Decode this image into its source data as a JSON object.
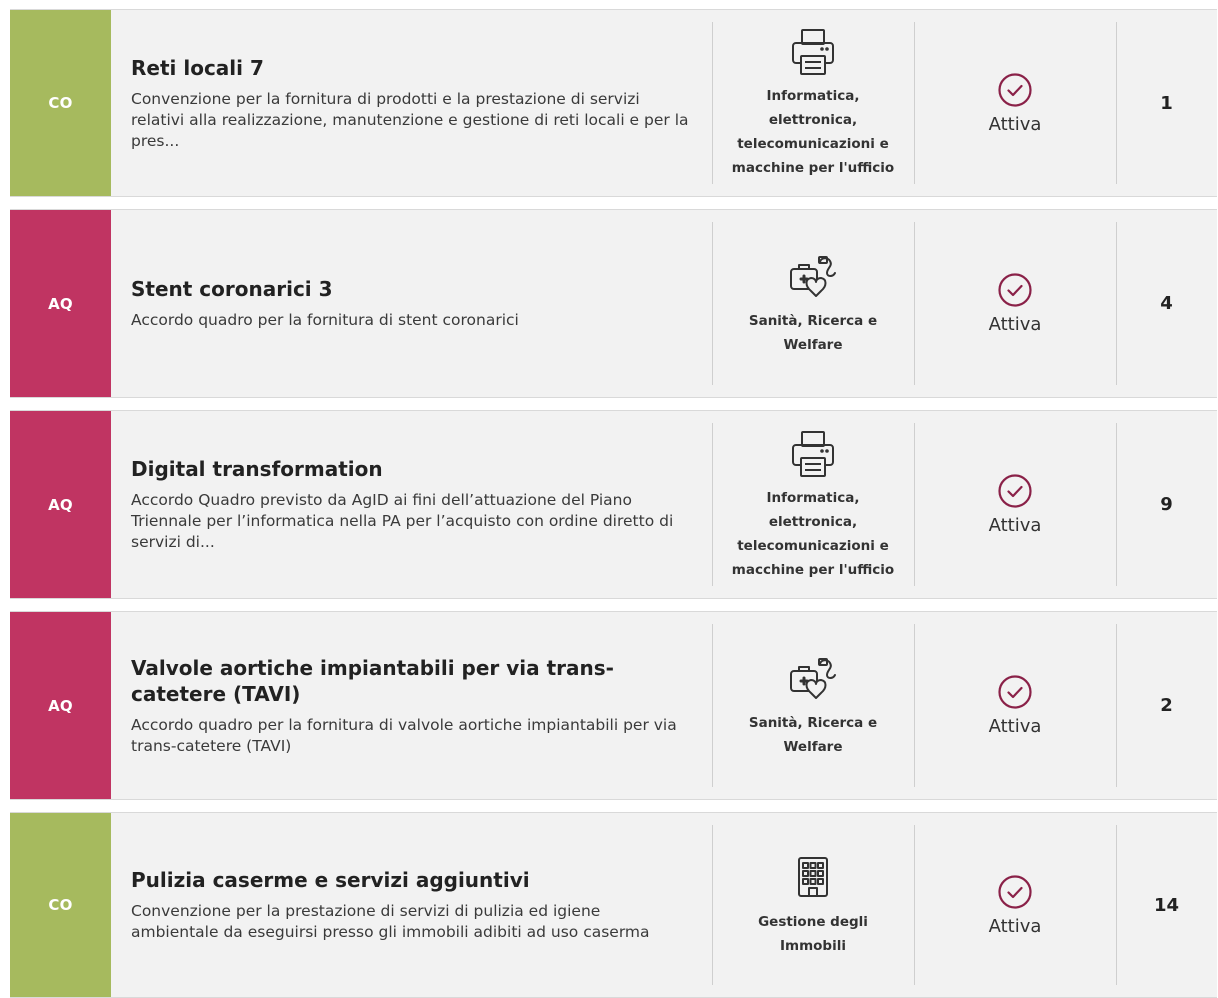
{
  "colors": {
    "co": "#a6ba5e",
    "aq": "#c03462",
    "status": "#8a2148"
  },
  "items": [
    {
      "type": "CO",
      "title": "Reti locali 7",
      "description": "Convenzione per la fornitura di prodotti e la prestazione di servizi relativi alla realizzazione, manutenzione e gestione di reti locali e per la pres...",
      "category_icon": "printer-icon",
      "category": "Informatica, elettronica, telecomunicazioni e macchine per l'ufficio",
      "status": "Attiva",
      "count": "1"
    },
    {
      "type": "AQ",
      "title": "Stent coronarici 3",
      "description": "Accordo quadro per la fornitura di stent coronarici",
      "category_icon": "health-icon",
      "category": "Sanità, Ricerca e Welfare",
      "status": "Attiva",
      "count": "4"
    },
    {
      "type": "AQ",
      "title": "Digital transformation",
      "description": "Accordo Quadro previsto da AgID ai fini dell’attuazione del Piano Triennale per l’informatica nella PA per l’acquisto con ordine diretto di servizi di...",
      "category_icon": "printer-icon",
      "category": "Informatica, elettronica, telecomunicazioni e macchine per l'ufficio",
      "status": "Attiva",
      "count": "9"
    },
    {
      "type": "AQ",
      "title": "Valvole aortiche impiantabili per via trans-catetere (TAVI)",
      "description": "Accordo quadro per la fornitura di valvole aortiche impiantabili per via trans-catetere (TAVI)",
      "category_icon": "health-icon",
      "category": "Sanità, Ricerca e Welfare",
      "status": "Attiva",
      "count": "2"
    },
    {
      "type": "CO",
      "title": "Pulizia caserme e servizi aggiuntivi",
      "description": "Convenzione per la prestazione di servizi di pulizia ed igiene ambientale da eseguirsi presso gli immobili adibiti ad uso caserma",
      "category_icon": "building-icon",
      "category": "Gestione degli Immobili",
      "status": "Attiva",
      "count": "14"
    }
  ]
}
